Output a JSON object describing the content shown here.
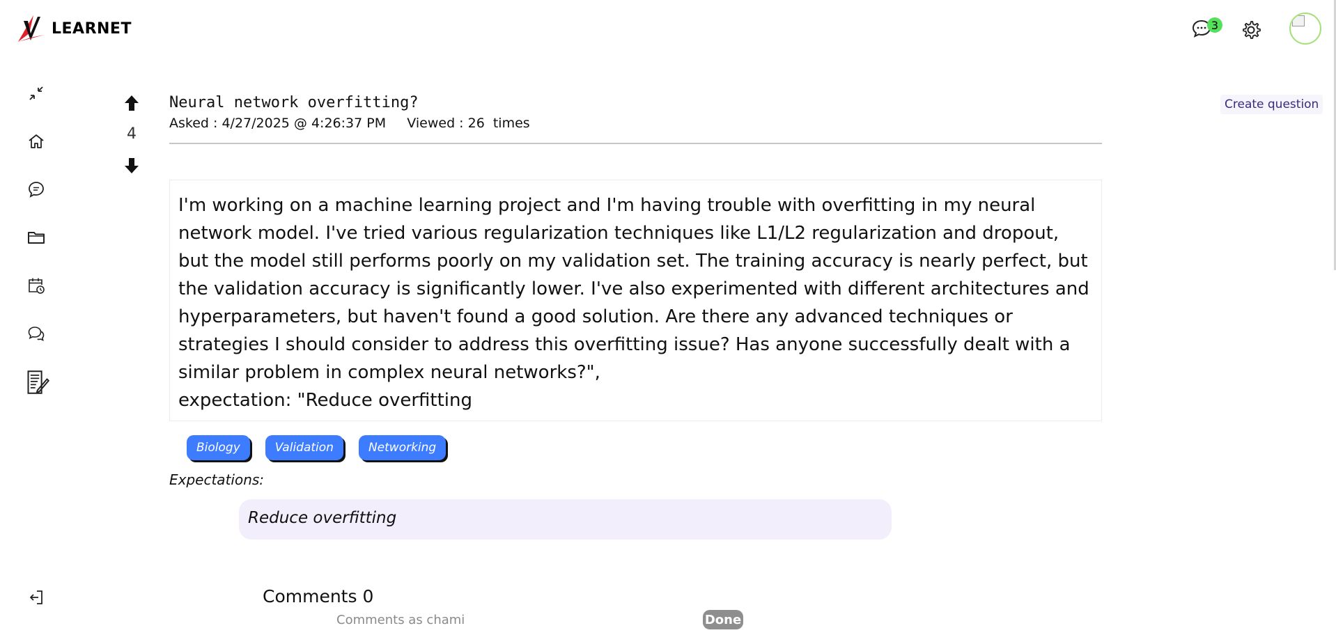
{
  "brand": {
    "name": "LEARNET",
    "logo_colors": {
      "red": "#e0202a",
      "dark": "#111111"
    }
  },
  "header": {
    "notifications_count": "3",
    "badge_color": "#55e05a"
  },
  "sidebar": {
    "items": [
      {
        "icon": "collapse-icon"
      },
      {
        "icon": "home-icon"
      },
      {
        "icon": "chat-bubble-icon"
      },
      {
        "icon": "folder-icon"
      },
      {
        "icon": "calendar-clock-icon"
      },
      {
        "icon": "conversation-icon"
      },
      {
        "icon": "notes-edit-icon"
      }
    ],
    "logout_icon": "logout-icon"
  },
  "question": {
    "votes": "4",
    "title": "Neural network overfitting?",
    "meta": "Asked : 4/27/2025 @ 4:26:37 PM     Viewed : 26  times",
    "body": "I'm working on a machine learning project and I'm having trouble with overfitting in my neural network model. I've tried various regularization techniques like L1/L2 regularization and dropout, but the model still performs poorly on my validation set. The training accuracy is nearly perfect, but the validation accuracy is significantly lower. I've also experimented with different architectures and hyperparameters, but haven't found a good solution. Are there any advanced techniques or strategies I should consider to address this overfitting issue? Has anyone successfully dealt with a similar problem in complex neural networks?\",\nexpectation: \"Reduce overfitting",
    "tags": [
      "Biology",
      "Validation",
      "Networking"
    ],
    "tag_color": "#3d7cff",
    "expectations_label": "Expectations:",
    "expectation": "Reduce overfitting"
  },
  "actions": {
    "create_question": "Create question"
  },
  "comments": {
    "title": "Comments 0",
    "comment_as": "Comments as chami",
    "done": "Done"
  }
}
